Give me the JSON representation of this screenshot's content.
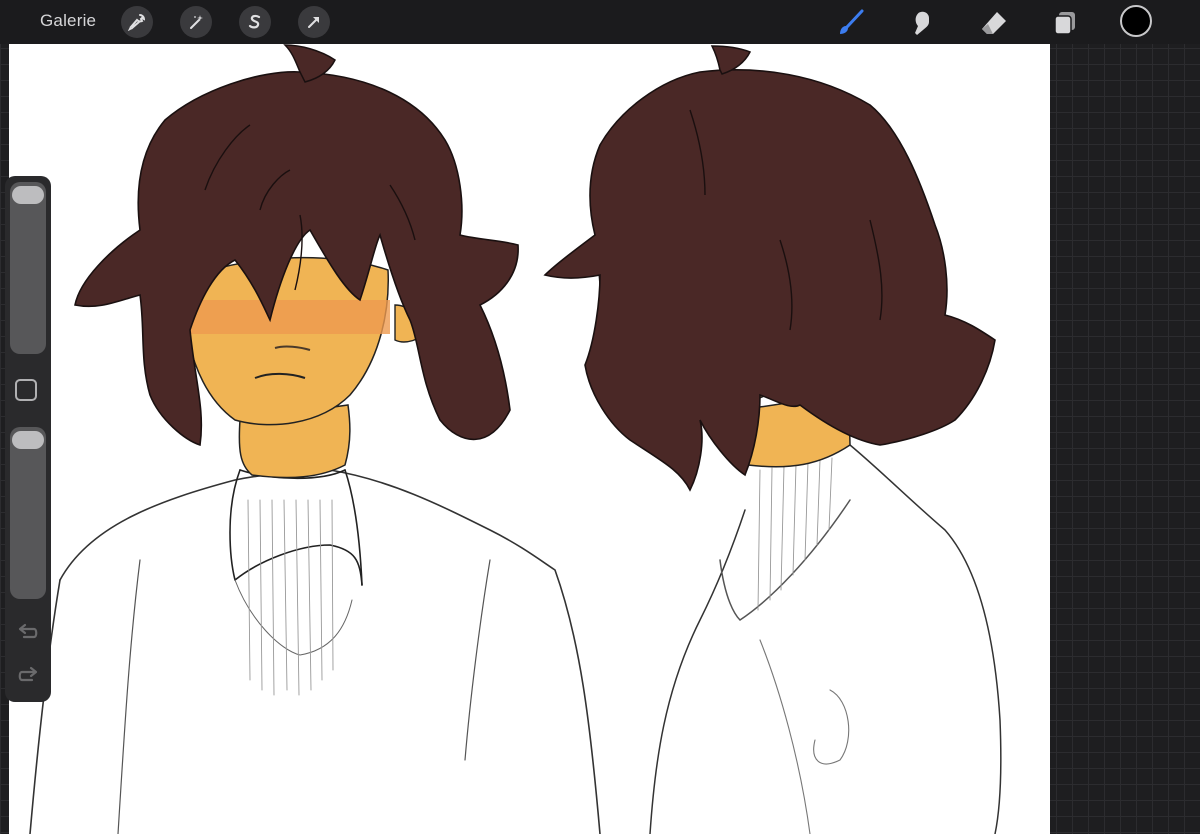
{
  "topbar": {
    "gallery_label": "Galerie",
    "left_tools": [
      {
        "icon": "wrench-icon"
      },
      {
        "icon": "magic-wand-icon"
      },
      {
        "icon": "selection-s-icon"
      },
      {
        "icon": "transform-arrow-icon"
      }
    ],
    "right_tools": [
      {
        "icon": "brush-icon",
        "active": true
      },
      {
        "icon": "smudge-icon"
      },
      {
        "icon": "eraser-icon"
      },
      {
        "icon": "layers-icon"
      }
    ],
    "current_color": "#000000"
  },
  "sidebar": {
    "brush_size_level": 0.98,
    "opacity_level": 0.98,
    "modify_icon": "square-icon",
    "undo_icon": "undo-icon",
    "redo_icon": "redo-icon"
  },
  "colors": {
    "active_tool": "#3c7df0",
    "hair": "#4a2826",
    "skin": "#f0b454",
    "blush": "#ee9a4f"
  }
}
